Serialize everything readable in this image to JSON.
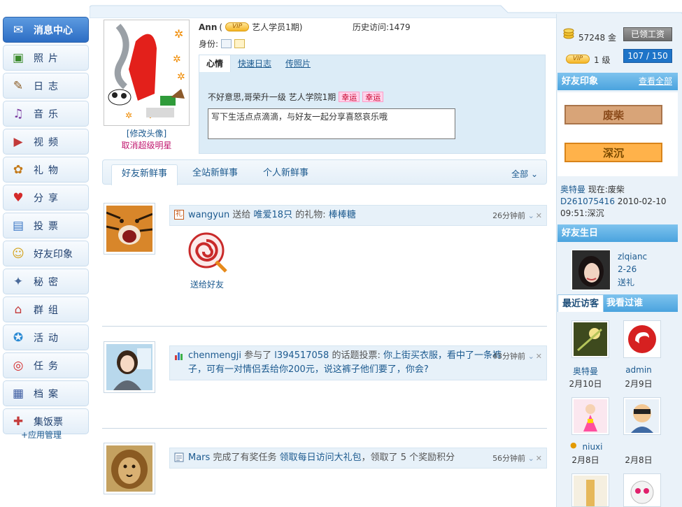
{
  "nav": {
    "items": [
      {
        "label": "消息中心",
        "icon": "message-center-icon"
      },
      {
        "label": "照片",
        "icon": "photo-icon"
      },
      {
        "label": "日志",
        "icon": "blog-icon"
      },
      {
        "label": "音乐",
        "icon": "music-icon"
      },
      {
        "label": "视频",
        "icon": "video-icon"
      },
      {
        "label": "礼物",
        "icon": "gift-icon"
      },
      {
        "label": "分享",
        "icon": "share-icon"
      },
      {
        "label": "投票",
        "icon": "vote-icon"
      },
      {
        "label": "好友印象",
        "icon": "friend-impression-icon"
      },
      {
        "label": "秘密",
        "icon": "secret-icon"
      },
      {
        "label": "群组",
        "icon": "group-icon"
      },
      {
        "label": "活动",
        "icon": "event-icon"
      },
      {
        "label": "任务",
        "icon": "task-icon"
      },
      {
        "label": "档案",
        "icon": "archive-icon"
      },
      {
        "label": "集饭票",
        "icon": "ticket-icon"
      }
    ],
    "app_manage": "+应用管理"
  },
  "profile": {
    "name": "Ann",
    "open_paren": "(",
    "vip": "VIP",
    "title": "艺人学员1期)",
    "visits": "历史访问:1479",
    "identity_label": "身份:",
    "edit_avatar": "[修改头像]",
    "cancel_star": "取消超级明星"
  },
  "status": {
    "tabs": [
      "心情",
      "快速日志",
      "传照片"
    ],
    "text": "不好意思,哥荣升一级  艺人学院1期",
    "lucky": "幸运",
    "input_value": "写下生活点点滴滴，与好友一起分享喜怒哀乐哦"
  },
  "feed_tabs": {
    "tabs": [
      "好友新鲜事",
      "全站新鲜事",
      "个人新鲜事"
    ],
    "all": "全部"
  },
  "feed": [
    {
      "icon": "gift-icon",
      "user": "wangyun",
      "verb": " 送给 ",
      "target": "唯爱18只",
      "mid": " 的礼物: ",
      "object": "棒棒糖",
      "time": "26分钟前",
      "caption": "送给好友"
    },
    {
      "icon": "vote-icon",
      "user": "chenmengji",
      "verb": " 参与了 ",
      "target": "l394517058",
      "mid": " 的话题投票: ",
      "object": "你上街买衣服，看中了一条裤子，可有一对情侣丢给你200元，说这裤子他们要了，你会?",
      "time": "43分钟前"
    },
    {
      "icon": "task-icon",
      "user": "Mars",
      "verb": " 完成了有奖任务 ",
      "target": "领取每日访问大礼包",
      "mid": "，领取了 5 个奖励积分",
      "object": "",
      "time": "56分钟前"
    }
  ],
  "sidebar": {
    "gold": "57248 金",
    "salary_button": "已领工资",
    "vip": "VIP",
    "level": "1 级",
    "exp": "107 / 150",
    "impression_title": "好友印象",
    "impression_more": "查看全部",
    "impressions": [
      "废柴",
      "深沉"
    ],
    "impression_log": [
      {
        "user": "奥特曼",
        "when": "现在:",
        "tag": "废柴"
      },
      {
        "user": "D261075416",
        "when": "2010-02-10 09:51:",
        "tag": "深沉"
      }
    ],
    "birthday_title": "好友生日",
    "birthday": {
      "name": "zlqianc",
      "date": "2-26",
      "action": "送礼"
    },
    "visitors_tab": "最近访客",
    "visited_tab": "我看过谁",
    "visitors": [
      {
        "name": "奥特曼",
        "date": "2月10日"
      },
      {
        "name": "admin",
        "date": "2月9日"
      },
      {
        "name": "niuxi",
        "date": "2月8日"
      },
      {
        "name": "",
        "date": "2月8日"
      }
    ]
  }
}
